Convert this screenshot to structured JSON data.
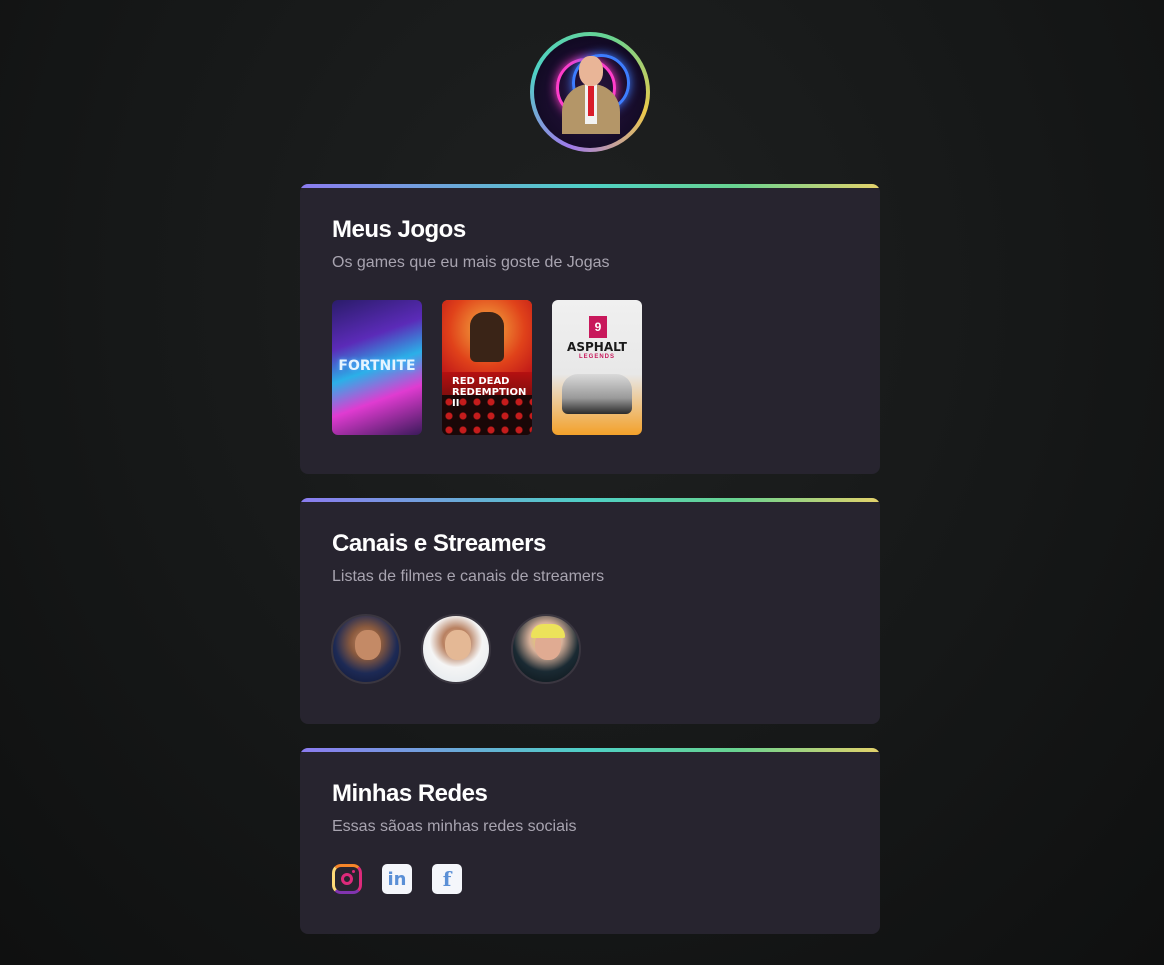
{
  "profile": {
    "avatar_alt": "profile-photo"
  },
  "sections": {
    "games": {
      "title": "Meus Jogos",
      "subtitle": "Os games que eu mais goste de Jogas",
      "items": [
        {
          "name": "FORTNITE"
        },
        {
          "name": "RED DEAD REDEMPTION II"
        },
        {
          "name": "ASPHALT",
          "badge": "9",
          "tagline": "LEGENDS"
        }
      ]
    },
    "streamers": {
      "title": "Canais e Streamers",
      "subtitle": "Listas de filmes e canais de streamers"
    },
    "social": {
      "title": "Minhas Redes",
      "subtitle": "Essas sãoas minhas redes sociais",
      "items": [
        {
          "name": "instagram",
          "icon": "instagram-icon"
        },
        {
          "name": "linkedin",
          "icon": "linkedin-icon",
          "glyph": "in"
        },
        {
          "name": "facebook",
          "icon": "facebook-icon",
          "glyph": "f"
        }
      ]
    }
  },
  "colors": {
    "background": "#161818",
    "card": "#27242f",
    "gradient": [
      "#8b7bf0",
      "#4fd1c5",
      "#68d391",
      "#e4d26b"
    ],
    "subtitle": "#a8a4b0"
  }
}
